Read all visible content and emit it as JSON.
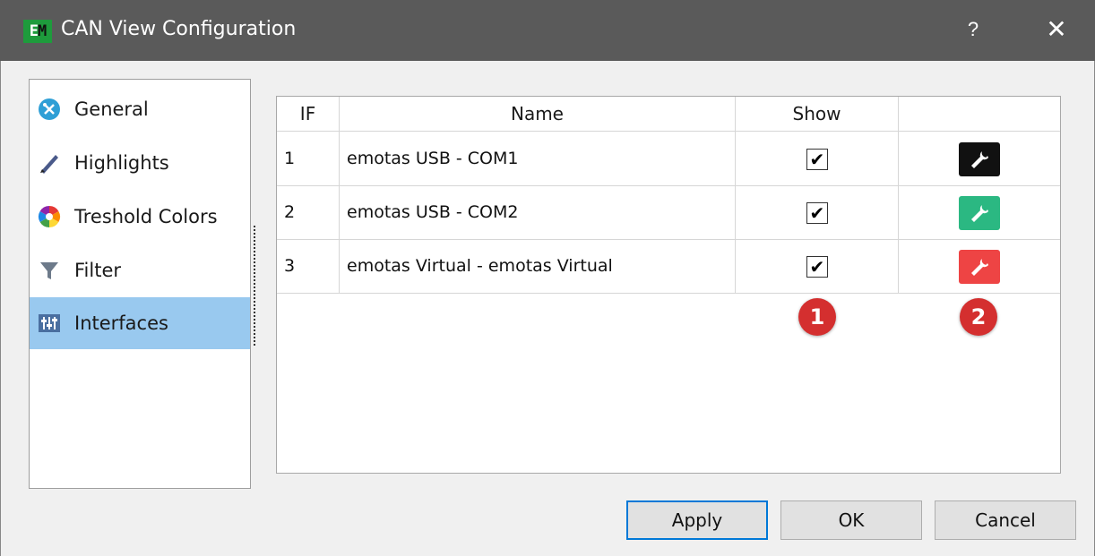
{
  "window": {
    "title": "CAN View Configuration",
    "logo_text_e": "E",
    "logo_text_m": "M",
    "help_label": "?",
    "close_label": "✕"
  },
  "nav": {
    "items": [
      {
        "label": "General",
        "icon": "general-settings-icon",
        "selected": false
      },
      {
        "label": "Highlights",
        "icon": "pen-icon",
        "selected": false
      },
      {
        "label": "Treshold Colors",
        "icon": "color-wheel-icon",
        "selected": false
      },
      {
        "label": "Filter",
        "icon": "funnel-icon",
        "selected": false
      },
      {
        "label": "Interfaces",
        "icon": "sliders-icon",
        "selected": true
      }
    ]
  },
  "table": {
    "columns": [
      "IF",
      "Name",
      "Show",
      ""
    ],
    "rows": [
      {
        "if": "1",
        "name": "emotas USB - COM1",
        "show": true,
        "config_color": "#111111"
      },
      {
        "if": "2",
        "name": "emotas USB - COM2",
        "show": true,
        "config_color": "#2bb882"
      },
      {
        "if": "3",
        "name": "emotas Virtual - emotas Virtual",
        "show": true,
        "config_color": "#ee4444"
      }
    ],
    "check_mark": "✔"
  },
  "badges": [
    "1",
    "2"
  ],
  "buttons": {
    "apply": "Apply",
    "ok": "OK",
    "cancel": "Cancel"
  },
  "colors": {
    "selection": "#99c9ef",
    "titlebar": "#5a5a5a",
    "badge": "#d42f2f",
    "default_button_border": "#0078d7"
  }
}
